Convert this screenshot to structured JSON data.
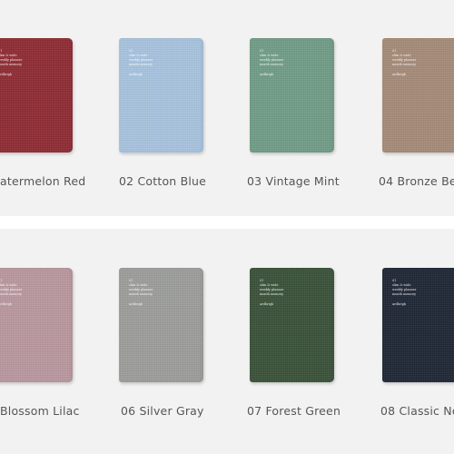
{
  "products": [
    {
      "label": "atermelon Red",
      "color": "#8e2a32"
    },
    {
      "label": "02 Cotton Blue",
      "color": "#a7c3df"
    },
    {
      "label": "03 Vintage Mint",
      "color": "#6f9c86"
    },
    {
      "label": "04 Bronze Be",
      "color": "#a48a77"
    },
    {
      "label": "Blossom Lilac",
      "color": "#b9979e"
    },
    {
      "label": "06 Silver Gray",
      "color": "#9c9d9b"
    },
    {
      "label": "07 Forest Green",
      "color": "#385037"
    },
    {
      "label": "08 Classic No",
      "color": "#1d2533"
    }
  ],
  "cover_lines": [
    "01",
    "slim & wide",
    "weekly planner",
    "month memory",
    "ardbrigh"
  ],
  "colors": {
    "background": "#f2f2f2",
    "divider": "#ffffff",
    "label_text": "#555555"
  }
}
